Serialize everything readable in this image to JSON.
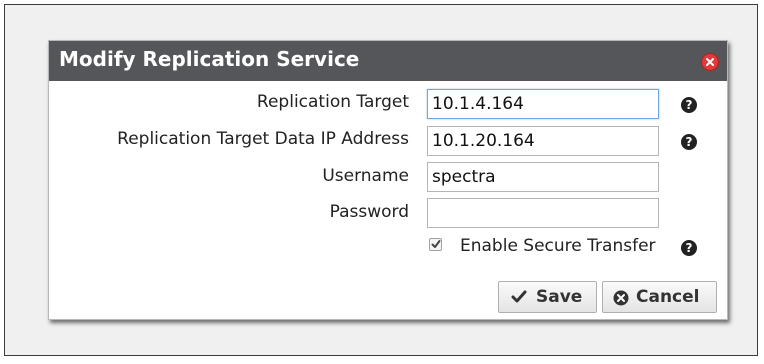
{
  "dialog": {
    "title": "Modify Replication Service"
  },
  "form": {
    "replication_target": {
      "label": "Replication Target",
      "value": "10.1.4.164"
    },
    "data_ip": {
      "label": "Replication Target Data IP Address",
      "value": "10.1.20.164"
    },
    "username": {
      "label": "Username",
      "value": "spectra"
    },
    "password": {
      "label": "Password",
      "value": ""
    },
    "secure_transfer": {
      "label": "Enable Secure Transfer",
      "checked": true
    }
  },
  "buttons": {
    "save": "Save",
    "cancel": "Cancel"
  },
  "help": {
    "glyph": "?"
  },
  "colors": {
    "title_bar": "#555659",
    "close": "#e03a3a"
  }
}
